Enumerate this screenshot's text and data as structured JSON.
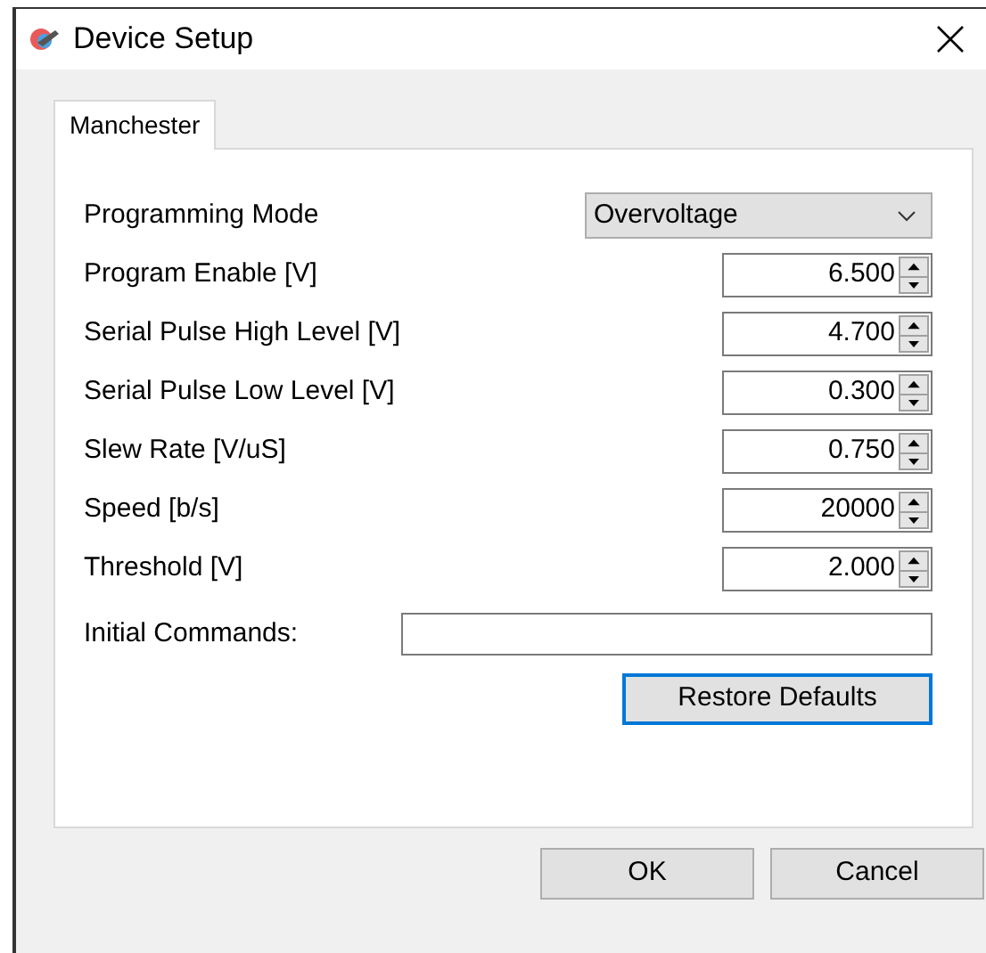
{
  "window": {
    "title": "Device Setup"
  },
  "tabs": [
    {
      "label": "Manchester",
      "selected": true
    }
  ],
  "mode": {
    "label": "Programming Mode",
    "value": "Overvoltage"
  },
  "settings": [
    {
      "label": "Program Enable [V]",
      "value": "6.500"
    },
    {
      "label": "Serial Pulse High Level [V]",
      "value": "4.700"
    },
    {
      "label": "Serial Pulse Low Level [V]",
      "value": "0.300"
    },
    {
      "label": "Slew Rate [V/uS]",
      "value": "0.750"
    },
    {
      "label": "Speed [b/s]",
      "value": "20000"
    },
    {
      "label": "Threshold [V]",
      "value": "2.000"
    }
  ],
  "initial_commands": {
    "label": "Initial Commands:"
  },
  "restore_button": {
    "label": "Restore Defaults",
    "focused": true
  },
  "buttons": [
    "OK",
    "Cancel"
  ]
}
